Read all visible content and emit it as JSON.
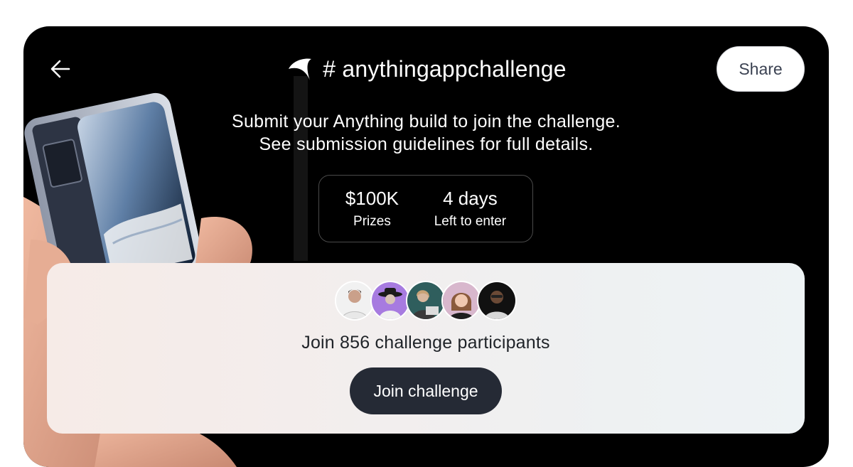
{
  "header": {
    "back_icon": "arrow-left-icon",
    "logo_icon": "anything-logo-icon",
    "title": "# anythingappchallenge",
    "share_label": "Share"
  },
  "intro": {
    "line1": "Submit your Anything build to join the challenge.",
    "line2": "See submission guidelines for full details."
  },
  "stats": [
    {
      "value": "$100K",
      "label": "Prizes"
    },
    {
      "value": "4 days",
      "label": "Left to enter"
    }
  ],
  "join": {
    "participants_text": "Join 856 challenge participants",
    "button_label": "Join challenge",
    "avatars": [
      {
        "name": "participant-avatar-1",
        "bg": "#f1f1f1"
      },
      {
        "name": "participant-avatar-2",
        "bg": "#a77be0"
      },
      {
        "name": "participant-avatar-3",
        "bg": "#3b6f6e"
      },
      {
        "name": "participant-avatar-4",
        "bg": "#d8b7cd"
      },
      {
        "name": "participant-avatar-5",
        "bg": "#111111"
      }
    ]
  },
  "colors": {
    "card_bg": "#000000",
    "button_dark": "#252a35",
    "panel_bg": "#f2eeee"
  }
}
